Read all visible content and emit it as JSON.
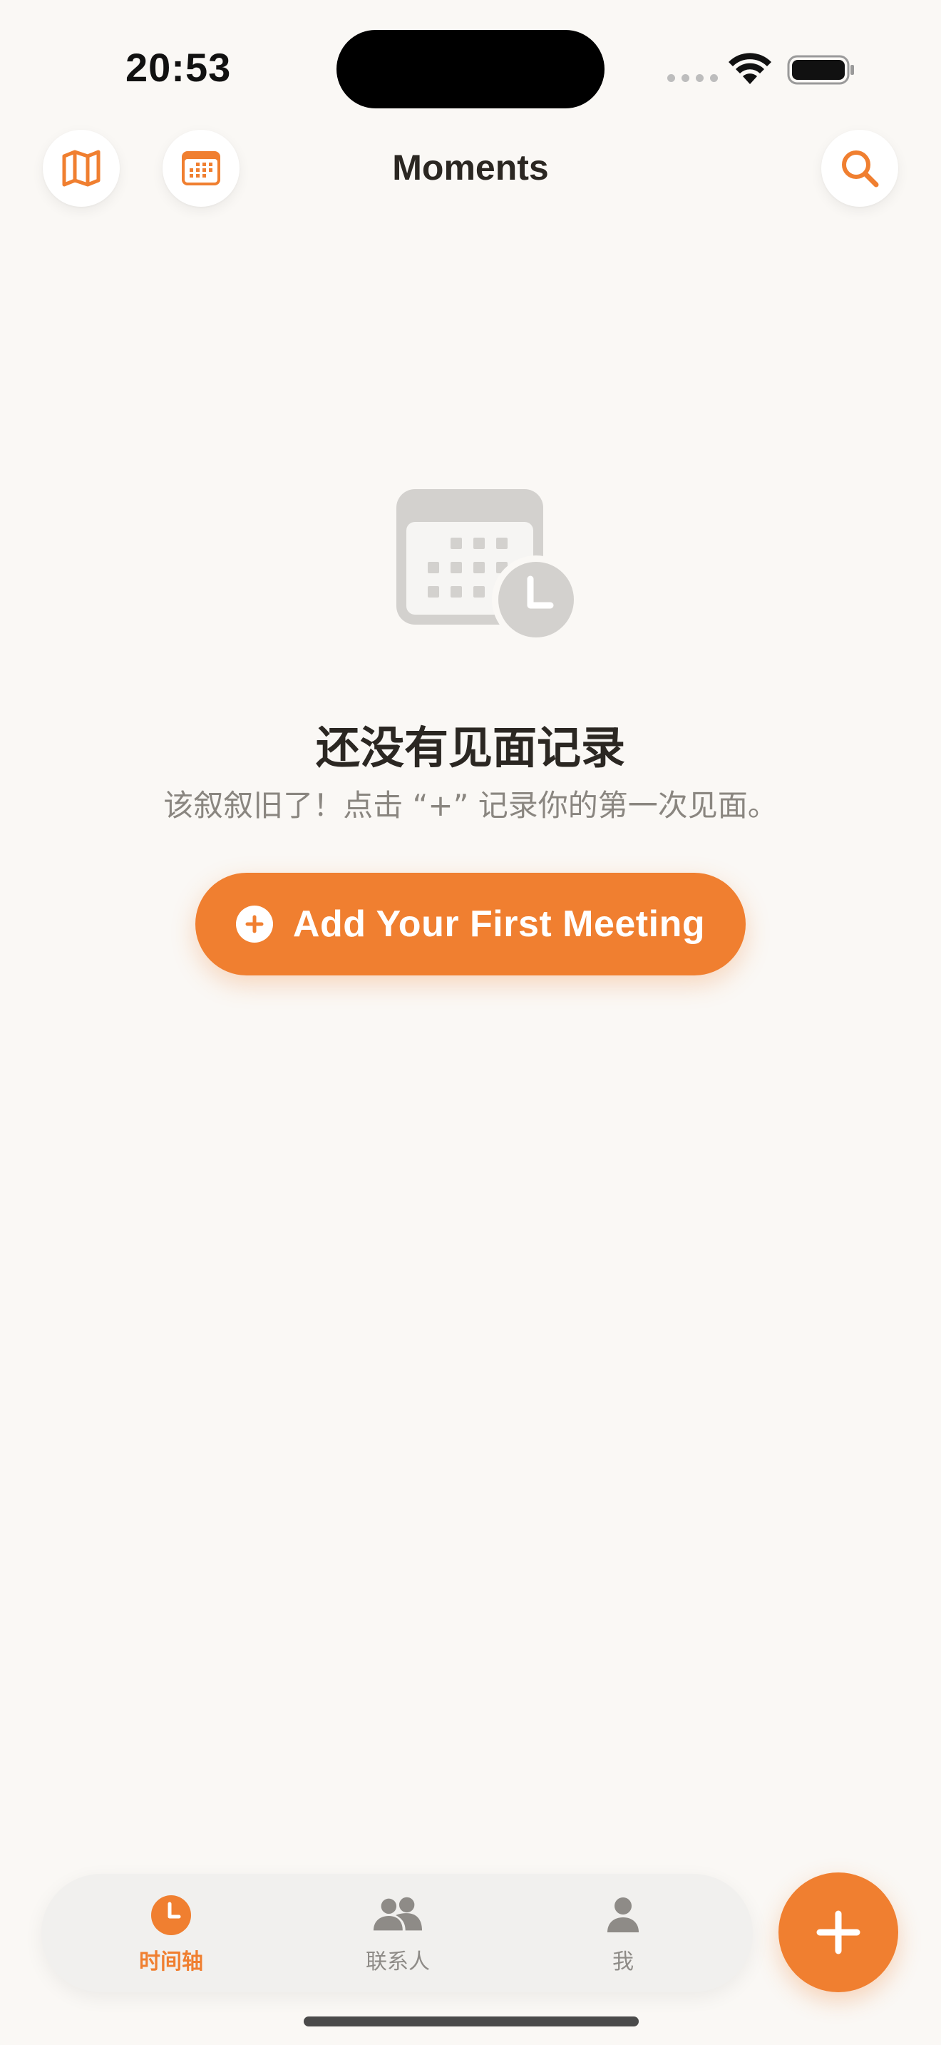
{
  "status_bar": {
    "time": "20:53"
  },
  "header": {
    "title": "Moments",
    "icons": {
      "map": "map-icon",
      "calendar": "calendar-icon",
      "search": "search-icon"
    }
  },
  "empty_state": {
    "icon": "calendar-clock-icon",
    "title": "还没有见面记录",
    "subtitle": "该叙叙旧了！点击 “+” 记录你的第一次见面。",
    "button_label": "Add Your First Meeting"
  },
  "tab_bar": {
    "tabs": [
      {
        "label": "时间轴",
        "icon": "clock-icon",
        "active": true
      },
      {
        "label": "联系人",
        "icon": "people-icon",
        "active": false
      },
      {
        "label": "我",
        "icon": "person-icon",
        "active": false
      }
    ]
  },
  "fab": {
    "icon": "plus-icon"
  },
  "colors": {
    "accent": "#F07F30",
    "background": "#FAF8F5",
    "text_primary": "#2B2722",
    "text_secondary": "#8A8680",
    "tab_inactive": "#8E8B87",
    "placeholder_icon": "#D3D1CE"
  }
}
